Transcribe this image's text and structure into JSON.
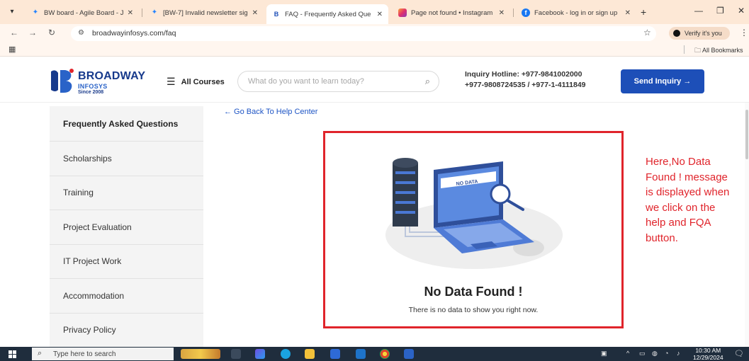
{
  "browser": {
    "tabs": [
      {
        "title": "BW board - Agile Board - Jir",
        "icon": "jira-icon",
        "color": "#2684ff"
      },
      {
        "title": "[BW-7] Invalid newsletter sig",
        "icon": "jira-icon",
        "color": "#2684ff"
      },
      {
        "title": "FAQ - Frequently Asked Que",
        "icon": "broadway-icon",
        "color": "#1d4fb8"
      },
      {
        "title": "Page not found • Instagram",
        "icon": "instagram-icon",
        "color": "#e1306c"
      },
      {
        "title": "Facebook - log in or sign up",
        "icon": "facebook-icon",
        "color": "#1877f2"
      }
    ],
    "new_tab": "+",
    "url": "broadwayinfosys.com/faq",
    "verify_label": "Verify it's you",
    "bookmarks_label": "All Bookmarks"
  },
  "header": {
    "logo_line1": "BROADWAY",
    "logo_line2": "INFOSYS",
    "logo_line3": "Since 2008",
    "all_courses": "All Courses",
    "search_placeholder": "What do you want to learn today?",
    "hotline_line1": "Inquiry Hotline: +977-9841002000",
    "hotline_line2": "+977-9808724535  / +977-1-4111849",
    "inquiry_button": "Send Inquiry →"
  },
  "sidebar": {
    "items": [
      {
        "label": "Frequently Asked Questions",
        "active": true
      },
      {
        "label": "Scholarships",
        "active": false
      },
      {
        "label": "Training",
        "active": false
      },
      {
        "label": "Project Evaluation",
        "active": false
      },
      {
        "label": "IT Project Work",
        "active": false
      },
      {
        "label": "Accommodation",
        "active": false
      },
      {
        "label": "Privacy Policy",
        "active": false
      }
    ]
  },
  "main": {
    "go_back": "← Go Back To Help Center",
    "empty_title": "No Data Found !",
    "empty_subtitle": "There is no data to show you right now.",
    "illustration_text": "NO DATA"
  },
  "annotation": {
    "text": "Here,No Data Found ! message is displayed when we click on the help and FQA button."
  },
  "taskbar": {
    "search_placeholder": "Type here to search",
    "time": "10:30 AM",
    "date": "12/29/2024"
  },
  "colors": {
    "accent": "#1d4fb8",
    "highlight_border": "#e0242b",
    "annotation_text": "#e0242b",
    "tab_strip": "#fde8d6"
  }
}
